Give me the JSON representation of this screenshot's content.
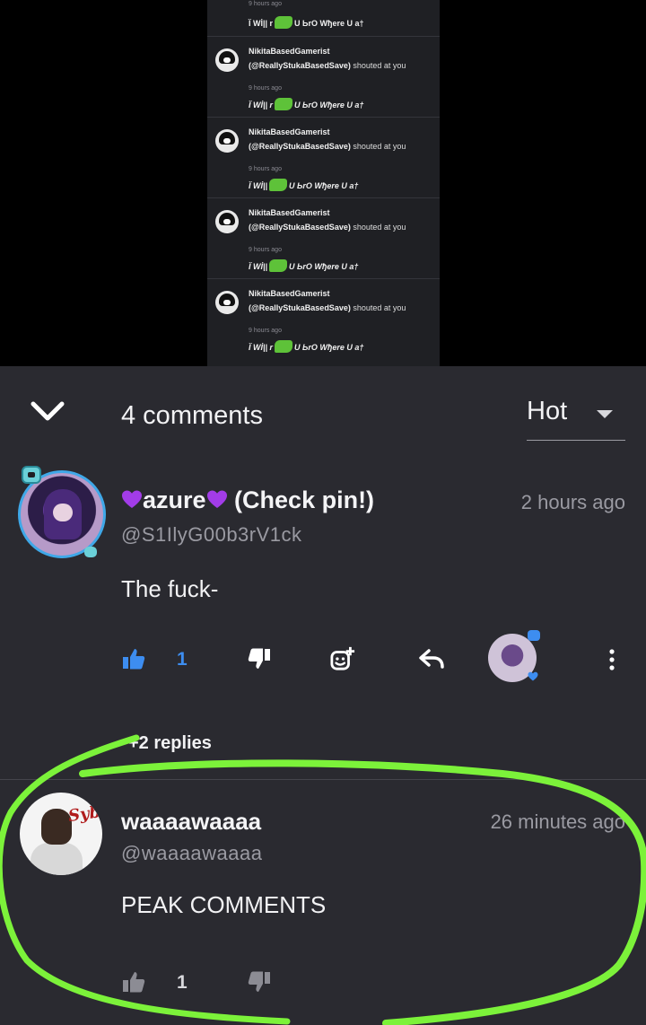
{
  "embed": {
    "top_time": "9 hours ago",
    "top_msg_pre": "Ï Wİ|| r",
    "top_msg_post": "U ЬrO Wђere U a†",
    "notifications": [
      {
        "name": "NikitaBasedGamerist",
        "handle": "(@ReallyStukaBasedSave)",
        "action": "shouted at you",
        "time": "9 hours ago",
        "msg_pre": "Ï Wİ|| r",
        "msg_post": "U ЬrO Wђere U a†"
      },
      {
        "name": "NikitaBasedGamerist",
        "handle": "(@ReallyStukaBasedSave)",
        "action": "shouted at you",
        "time": "9 hours ago",
        "msg_pre": "Ï Wİ||",
        "msg_post": "U ЬrO Wђere U a†"
      },
      {
        "name": "NikitaBasedGamerist",
        "handle": "(@ReallyStukaBasedSave)",
        "action": "shouted at you",
        "time": "9 hours ago",
        "msg_pre": "Ï Wİ||",
        "msg_post": "U ЬrO Wђere U a†"
      },
      {
        "name": "NikitaBasedGamerist",
        "handle": "(@ReallyStukaBasedSave)",
        "action": "shouted at you",
        "time": "9 hours ago",
        "msg_pre": "Ï Wİ|| r",
        "msg_post": "U ЬrO Wђere U a†"
      }
    ]
  },
  "header": {
    "count_label": "4 comments",
    "sort_label": "Hot"
  },
  "comments": [
    {
      "author": "azure",
      "author_suffix": " (Check pin!)",
      "handle": "@S1IlyG00b3rV1ck",
      "time": "2 hours ago",
      "body": "The fuck-",
      "likes": "1",
      "replies_label": "+2 replies"
    },
    {
      "author": "waaaawaaaa",
      "handle": "@waaaawaaaa",
      "time": "26 minutes ago",
      "body": "PEAK COMMENTS",
      "likes": "1",
      "avatar_sign": "Sybau"
    }
  ],
  "colors": {
    "background": "#2a2a30",
    "accent_blue": "#3d8df0",
    "muted_text": "#9a9aa2",
    "highlight_green": "#7cf23a",
    "heart_purple": "#a23ce8"
  },
  "icons": {
    "collapse": "chevron-down-icon",
    "sort": "caret-down-icon",
    "like": "thumbs-up-icon",
    "dislike": "thumbs-down-icon",
    "sticker": "sticker-add-icon",
    "reply": "reply-icon",
    "more": "more-vertical-icon"
  }
}
